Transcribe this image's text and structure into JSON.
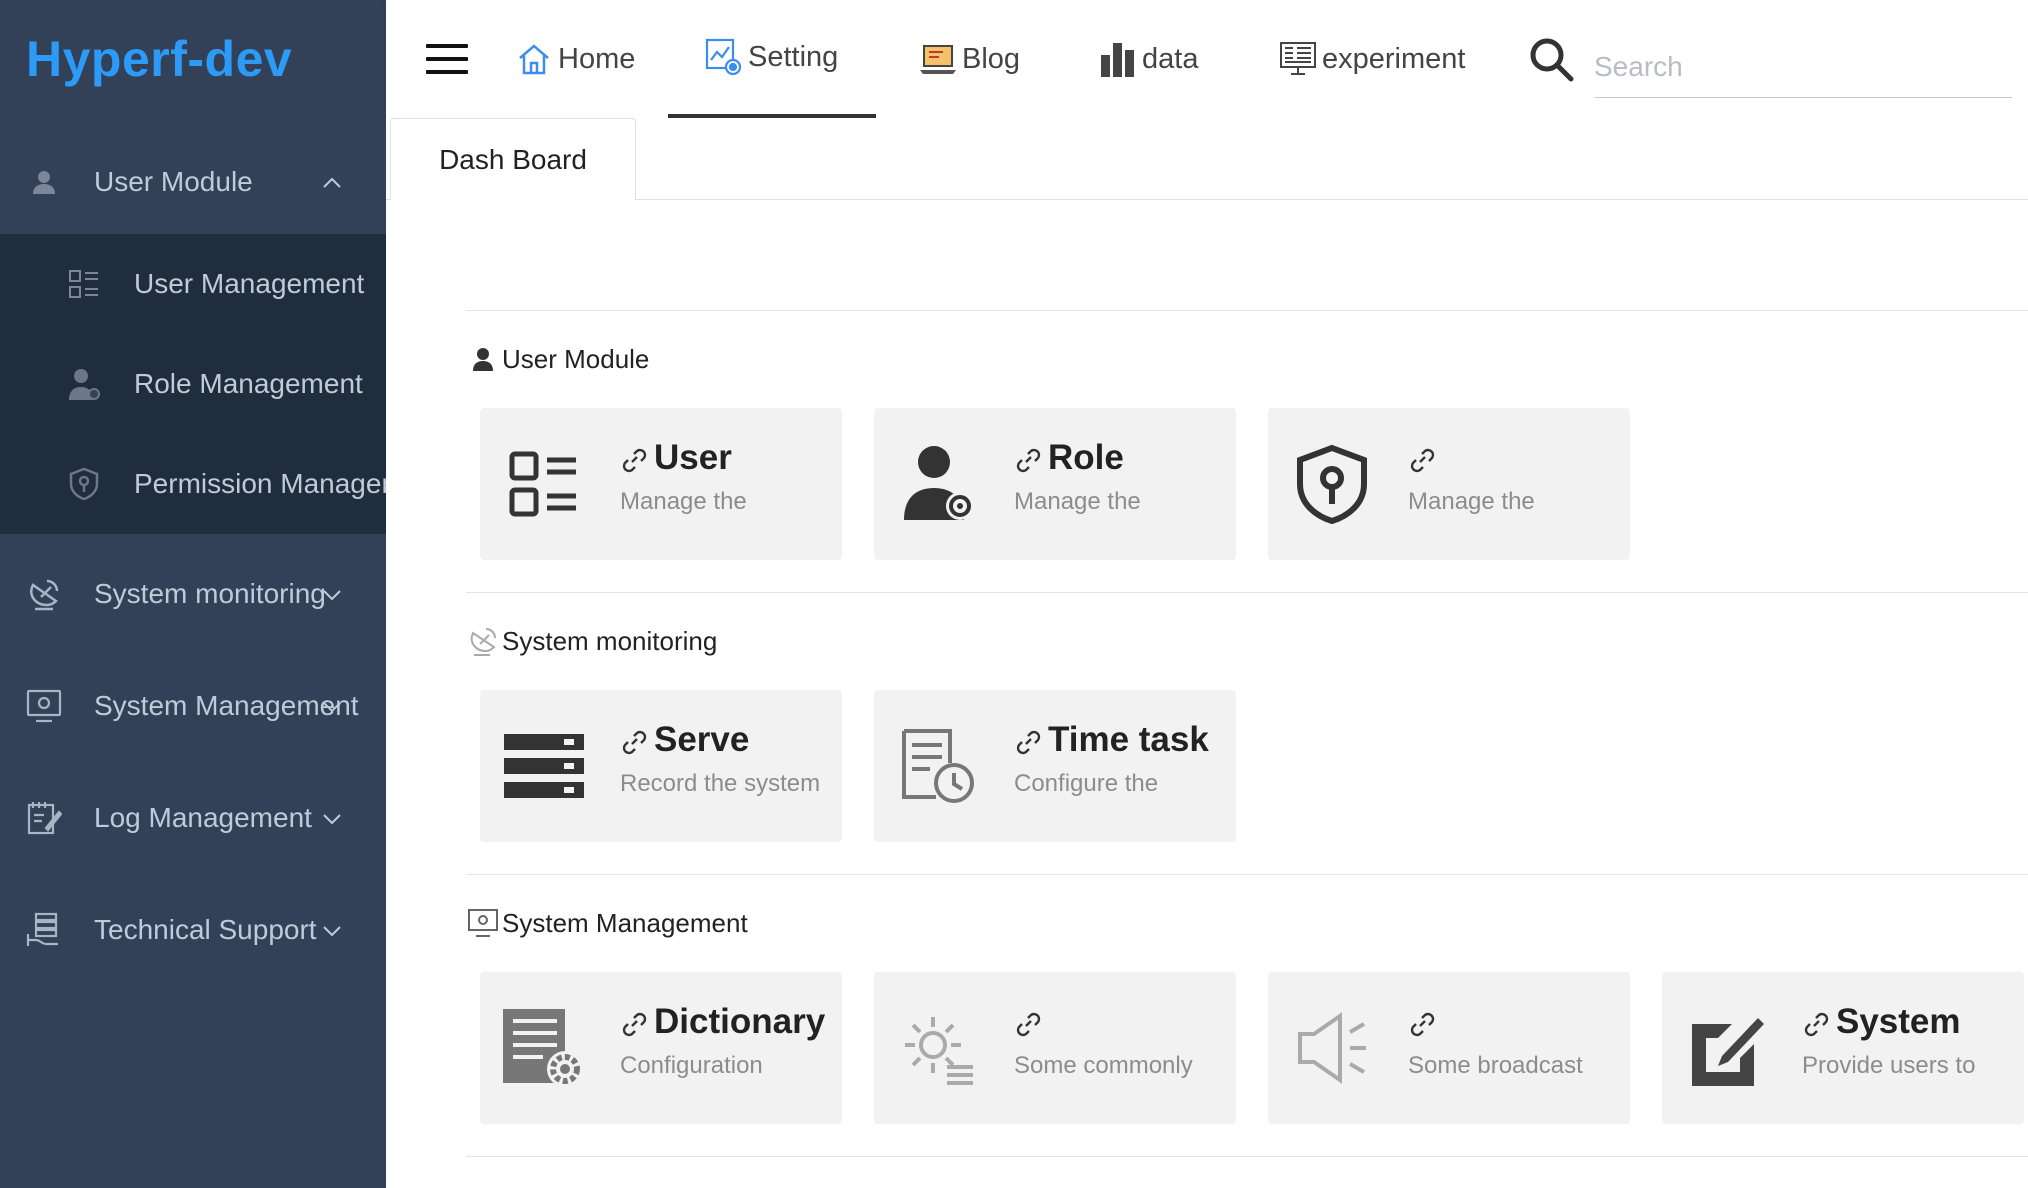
{
  "app": {
    "title": "Hyperf-dev"
  },
  "sidebar": {
    "items": [
      {
        "label": "User Module",
        "icon": "user-icon",
        "expanded": true,
        "children": [
          {
            "label": "User Management",
            "icon": "list-icon"
          },
          {
            "label": "Role Management",
            "icon": "user-gear-icon"
          },
          {
            "label": "Permission Management",
            "icon": "shield-key-icon"
          }
        ]
      },
      {
        "label": "System monitoring",
        "icon": "satellite-dish-icon"
      },
      {
        "label": "System Management",
        "icon": "monitor-gear-icon"
      },
      {
        "label": "Log Management",
        "icon": "notebook-pen-icon"
      },
      {
        "label": "Technical Support",
        "icon": "server-hand-icon"
      }
    ]
  },
  "topnav": {
    "tabs": [
      {
        "label": "Home",
        "icon": "home-icon"
      },
      {
        "label": "Setting",
        "icon": "chart-settings-icon",
        "active": true
      },
      {
        "label": "Blog",
        "icon": "laptop-icon"
      },
      {
        "label": "data",
        "icon": "bar-chart-icon"
      },
      {
        "label": "experiment",
        "icon": "monitor-grid-icon"
      }
    ],
    "search": {
      "placeholder": "Search",
      "value": ""
    }
  },
  "tabs": [
    {
      "label": "Dash Board",
      "active": true
    }
  ],
  "sections": [
    {
      "title": "User Module",
      "cards": [
        {
          "title": "User",
          "desc": "Manage the",
          "icon": "list-icon"
        },
        {
          "title": "Role",
          "desc": "Manage the",
          "icon": "user-gear-icon"
        },
        {
          "title": "",
          "desc": "Manage the",
          "icon": "shield-key-icon"
        }
      ]
    },
    {
      "title": "System monitoring",
      "cards": [
        {
          "title": "Serve",
          "desc": "Record the system",
          "icon": "server-rack-icon"
        },
        {
          "title": "Time task",
          "desc": "Configure the",
          "icon": "document-clock-icon"
        }
      ]
    },
    {
      "title": "System Management",
      "cards": [
        {
          "title": "Dictionary",
          "desc": "Configuration",
          "icon": "book-gear-icon"
        },
        {
          "title": "",
          "desc": "Some commonly",
          "icon": "gear-list-icon"
        },
        {
          "title": "",
          "desc": "Some broadcast",
          "icon": "speaker-icon"
        },
        {
          "title": "System",
          "desc": "Provide users to",
          "icon": "edit-icon"
        }
      ]
    }
  ],
  "colors": {
    "sidebar_bg": "#324157",
    "submenu_bg": "#1f2d3d",
    "logo": "#2c9af7",
    "card_bg": "#f2f2f2",
    "nav_icon_blue": "#3d8cf0"
  }
}
